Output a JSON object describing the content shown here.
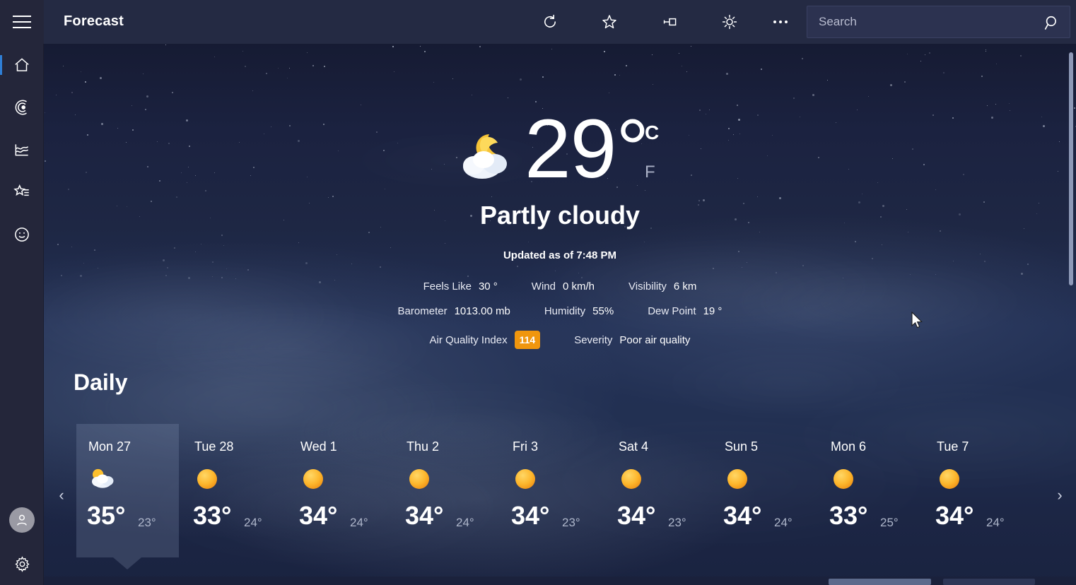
{
  "app": {
    "title": "Forecast",
    "menu_icon": "hamburger-icon"
  },
  "toolbar": {
    "refresh_label": "Refresh",
    "favorite_label": "Favorite",
    "pin_label": "Pin",
    "brightness_label": "Brightness",
    "more_label": "More options"
  },
  "search": {
    "placeholder": "Search",
    "value": "",
    "icon": "search-icon"
  },
  "sidebar": {
    "items": [
      {
        "name": "home",
        "icon": "home-icon",
        "active": true
      },
      {
        "name": "maps",
        "icon": "radar-icon",
        "active": false
      },
      {
        "name": "historical-weather",
        "icon": "line-chart-icon",
        "active": false
      },
      {
        "name": "favorites",
        "icon": "star-list-icon",
        "active": false
      },
      {
        "name": "news",
        "icon": "smiley-icon",
        "active": false
      }
    ],
    "account_icon": "person-icon",
    "settings_icon": "gear-icon"
  },
  "current": {
    "icon": "moon-behind-cloud-icon",
    "temperature": "29",
    "degree": "°",
    "unit_c": "C",
    "unit_f": "F",
    "selected_unit": "C",
    "condition": "Partly cloudy",
    "updated": "Updated as of 7:48 PM",
    "details": [
      {
        "label": "Feels Like",
        "value": "30 °"
      },
      {
        "label": "Wind",
        "value": "0 km/h"
      },
      {
        "label": "Visibility",
        "value": "6 km"
      },
      {
        "label": "Barometer",
        "value": "1013.00 mb"
      },
      {
        "label": "Humidity",
        "value": "55%"
      },
      {
        "label": "Dew Point",
        "value": "19 °"
      }
    ],
    "aqi": {
      "label": "Air Quality Index",
      "value": "114",
      "badge_color": "#f0960e",
      "severity_label": "Severity",
      "severity_value": "Poor air quality"
    }
  },
  "daily": {
    "heading": "Daily",
    "prev_label": "‹",
    "next_label": "›",
    "days": [
      {
        "name": "Mon 27",
        "icon": "sun-behind-cloud-icon",
        "high": "35°",
        "low": "23°",
        "selected": true
      },
      {
        "name": "Tue 28",
        "icon": "sunny-icon",
        "high": "33°",
        "low": "24°",
        "selected": false
      },
      {
        "name": "Wed 1",
        "icon": "sunny-icon",
        "high": "34°",
        "low": "24°",
        "selected": false
      },
      {
        "name": "Thu 2",
        "icon": "sunny-icon",
        "high": "34°",
        "low": "24°",
        "selected": false
      },
      {
        "name": "Fri 3",
        "icon": "sunny-icon",
        "high": "34°",
        "low": "23°",
        "selected": false
      },
      {
        "name": "Sat 4",
        "icon": "sunny-icon",
        "high": "34°",
        "low": "23°",
        "selected": false
      },
      {
        "name": "Sun 5",
        "icon": "sunny-icon",
        "high": "34°",
        "low": "24°",
        "selected": false
      },
      {
        "name": "Mon 6",
        "icon": "sunny-icon",
        "high": "33°",
        "low": "25°",
        "selected": false
      },
      {
        "name": "Tue 7",
        "icon": "sunny-icon",
        "high": "34°",
        "low": "24°",
        "selected": false
      }
    ]
  },
  "colors": {
    "accent": "#2f7fd6",
    "titlebar": "#242a43",
    "rail": "#24263a",
    "aqi": "#f0960e"
  }
}
